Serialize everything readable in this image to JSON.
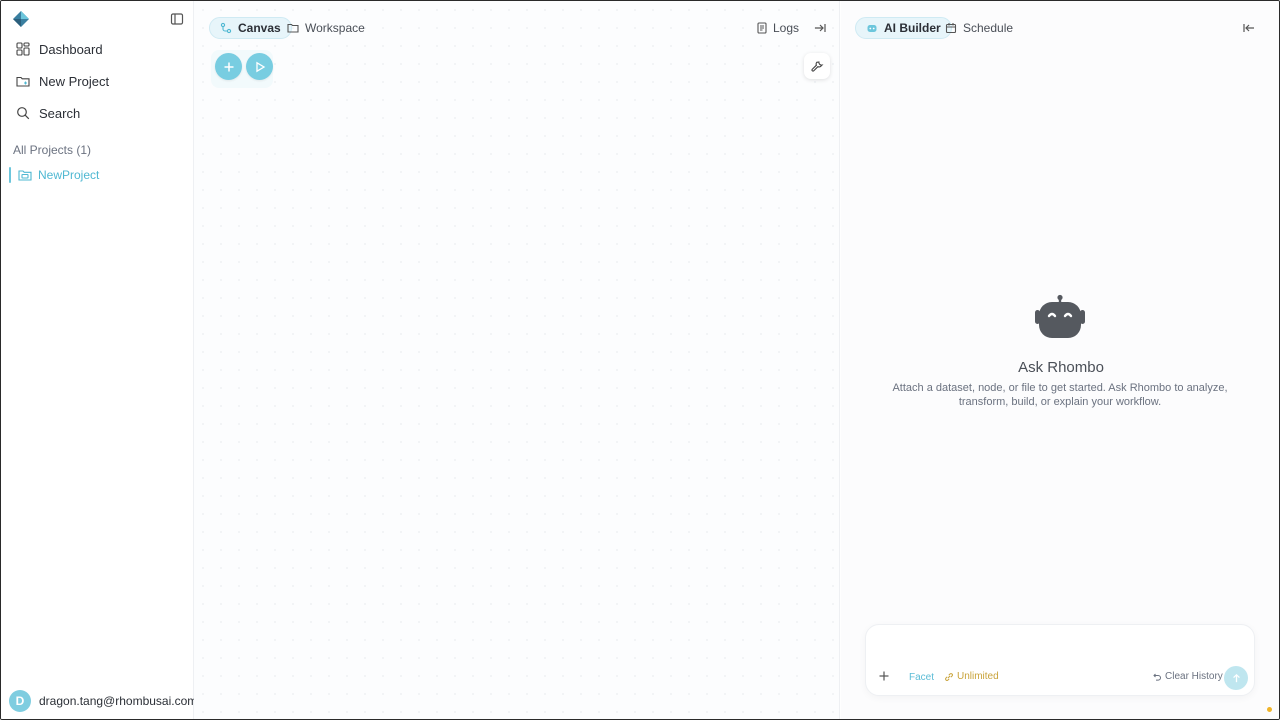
{
  "sidebar": {
    "nav": [
      {
        "label": "Dashboard",
        "icon": "grid-icon"
      },
      {
        "label": "New Project",
        "icon": "folder-plus-icon"
      },
      {
        "label": "Search",
        "icon": "search-icon"
      }
    ],
    "section_label": "All Projects (1)",
    "projects": [
      {
        "label": "NewProject",
        "icon": "folder-icon"
      }
    ],
    "user": {
      "initial": "D",
      "email": "dragon.tang@rhombusai.com"
    }
  },
  "canvas": {
    "tabs": [
      {
        "label": "Canvas",
        "icon": "workflow-icon",
        "active": true
      },
      {
        "label": "Workspace",
        "icon": "folder-open-icon",
        "active": false
      }
    ],
    "logs_label": "Logs"
  },
  "panel": {
    "tabs": [
      {
        "label": "AI Builder",
        "icon": "robot-icon",
        "active": true
      },
      {
        "label": "Schedule",
        "icon": "calendar-icon",
        "active": false
      }
    ],
    "empty_title": "Ask Rhombo",
    "empty_description": "Attach a dataset, node, or file to get started. Ask Rhombo to analyze, transform, build, or explain your workflow.",
    "composer": {
      "placeholder": "",
      "facet_label": "Facet",
      "unlimited_label": "Unlimited",
      "clear_label": "Clear History"
    }
  },
  "colors": {
    "accent": "#78cde1",
    "accent_text": "#4fb8d2",
    "warning": "#c9a33a"
  }
}
